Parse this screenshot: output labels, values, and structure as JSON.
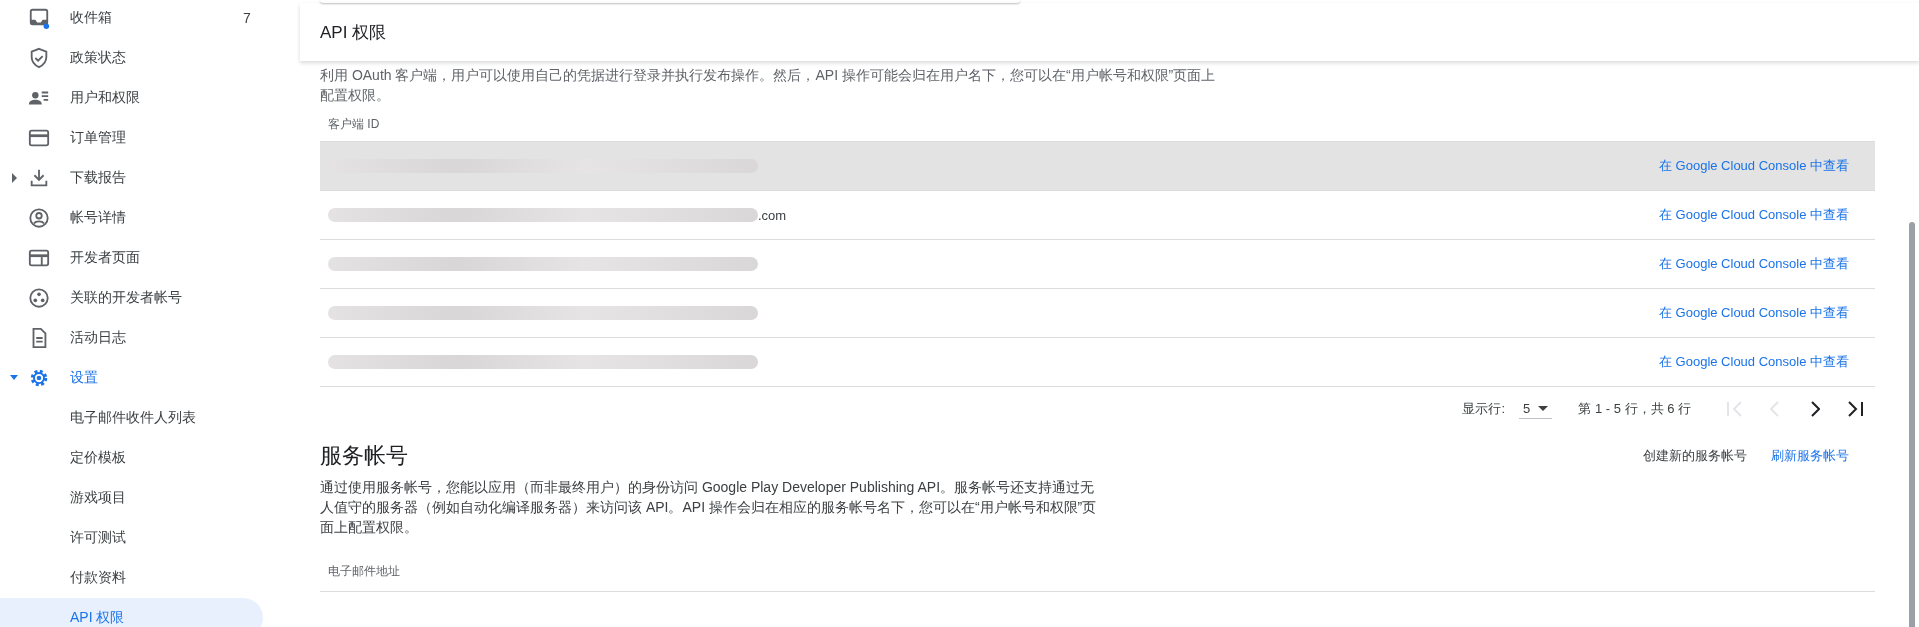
{
  "sidebar": {
    "items": [
      {
        "label": "收件箱",
        "badge": "7",
        "selected": false
      },
      {
        "label": "政策状态",
        "selected": false
      },
      {
        "label": "用户和权限",
        "selected": false
      },
      {
        "label": "订单管理",
        "selected": false
      },
      {
        "label": "下载报告",
        "selected": false,
        "expanded": false
      },
      {
        "label": "帐号详情",
        "selected": false
      },
      {
        "label": "开发者页面",
        "selected": false
      },
      {
        "label": "关联的开发者帐号",
        "selected": false
      },
      {
        "label": "活动日志",
        "selected": false
      },
      {
        "label": "设置",
        "selected": false,
        "expanded": true,
        "children": [
          {
            "label": "电子邮件收件人列表",
            "selected": false
          },
          {
            "label": "定价模板",
            "selected": false
          },
          {
            "label": "游戏项目",
            "selected": false
          },
          {
            "label": "许可测试",
            "selected": false
          },
          {
            "label": "付款资料",
            "selected": false
          },
          {
            "label": "API 权限",
            "selected": true
          }
        ]
      }
    ]
  },
  "header": {
    "title": "API 权限"
  },
  "oauth": {
    "description": "利用 OAuth 客户端，用户可以使用自己的凭据进行登录并执行发布操作。然后，API 操作可能会归在用户名下，您可以在“用户帐号和权限”页面上配置权限。",
    "table": {
      "columns": [
        "客户端 ID"
      ],
      "rows": [
        {
          "selected": true,
          "link": "在 Google Cloud Console 中查看"
        },
        {
          "selected": false,
          "client_id_tail": ".com",
          "link": "在 Google Cloud Console 中查看"
        },
        {
          "selected": false,
          "link": "在 Google Cloud Console 中查看"
        },
        {
          "selected": false,
          "link": "在 Google Cloud Console 中查看"
        },
        {
          "selected": false,
          "link": "在 Google Cloud Console 中查看"
        }
      ]
    },
    "pagination": {
      "rows_label": "显示行:",
      "rows_per_page": "5",
      "range": "第 1 - 5 行，共 6 行",
      "buttons": [
        {
          "kind": "first",
          "disabled": true
        },
        {
          "kind": "prev",
          "disabled": true
        },
        {
          "kind": "next",
          "disabled": false
        },
        {
          "kind": "last",
          "disabled": false
        }
      ]
    }
  },
  "service_accounts": {
    "title": "服务帐号",
    "actions": [
      {
        "label": "创建新的服务帐号",
        "kind": "secondary"
      },
      {
        "label": "刷新服务帐号",
        "kind": "primary"
      }
    ],
    "description": "通过使用服务帐号，您能以应用（而非最终用户）的身份访问 Google Play Developer Publishing API。服务帐号还支持通过无人值守的服务器（例如自动化编译服务器）来访问该 API。API 操作会归在相应的服务帐号名下，您可以在“用户帐号和权限”页面上配置权限。",
    "table": {
      "columns": [
        "电子邮件地址"
      ]
    }
  }
}
